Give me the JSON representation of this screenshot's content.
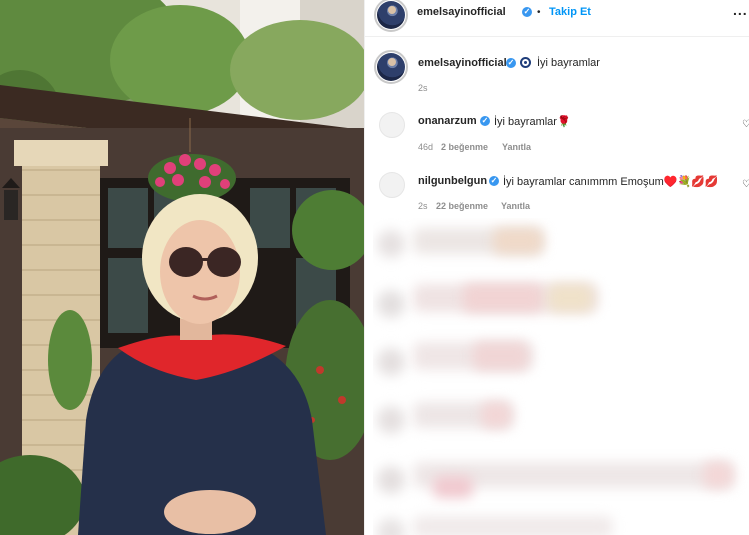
{
  "post": {
    "author": "emelsayinofficial",
    "follow_label": "Takip Et",
    "separator": "•",
    "more_label": "...",
    "caption": {
      "username": "emelsayinofficial",
      "text": "İyi bayramlar",
      "age": "2s"
    }
  },
  "comments": [
    {
      "username": "onanarzum",
      "text": "İyi bayramlar🌹",
      "age": "46d",
      "likes": "2 beğenme",
      "reply_label": "Yanıtla"
    },
    {
      "username": "nilgunbelgun",
      "text": "İyi bayramlar canımmm Emoşum♥️💐💋💋",
      "age": "2s",
      "likes": "22 beğenme",
      "reply_label": "Yanıtla"
    }
  ],
  "icons": {
    "verified": "verified-badge-icon",
    "heart": "heart-icon",
    "more": "more-options-icon"
  },
  "colors": {
    "link_blue": "#0095f6",
    "verified_blue": "#3897f0",
    "text": "#262626",
    "muted": "#8e8e8e"
  }
}
